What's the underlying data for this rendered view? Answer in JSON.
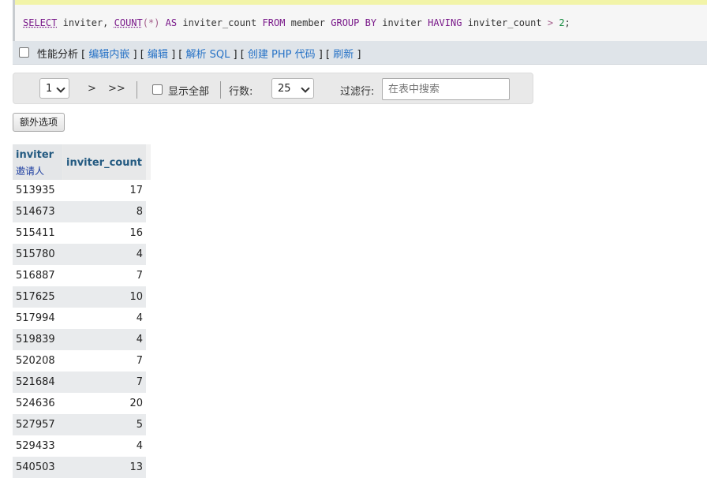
{
  "sql": {
    "select": "SELECT",
    "col1": "inviter,",
    "fn": "COUNT",
    "paren_star": "(*)",
    "as": "AS",
    "alias": "inviter_count",
    "from": "FROM",
    "table": "member",
    "group_by": "GROUP BY",
    "group_col": "inviter",
    "having": "HAVING",
    "having_col": "inviter_count",
    "gt": ">",
    "value": "2",
    "semicolon": ";"
  },
  "profiling": {
    "label": "性能分析",
    "links": [
      "编辑内嵌",
      "编辑",
      "解析 SQL",
      "创建 PHP 代码",
      "刷新"
    ]
  },
  "nav": {
    "page_value": "1",
    "next": ">",
    "last": ">>",
    "show_all": "显示全部",
    "rows_label": "行数:",
    "rows_value": "25",
    "filter_label": "过滤行:",
    "filter_placeholder": "在表中搜索"
  },
  "extra_options": "额外选项",
  "table": {
    "col1": {
      "name": "inviter",
      "comment": "邀请人"
    },
    "col2": {
      "name": "inviter_count"
    },
    "rows": [
      [
        "513935",
        "17"
      ],
      [
        "514673",
        "8"
      ],
      [
        "515411",
        "16"
      ],
      [
        "515780",
        "4"
      ],
      [
        "516887",
        "7"
      ],
      [
        "517625",
        "10"
      ],
      [
        "517994",
        "4"
      ],
      [
        "519839",
        "4"
      ],
      [
        "520208",
        "7"
      ],
      [
        "521684",
        "7"
      ],
      [
        "524636",
        "20"
      ],
      [
        "527957",
        "5"
      ],
      [
        "529433",
        "4"
      ],
      [
        "540503",
        "13"
      ]
    ]
  }
}
